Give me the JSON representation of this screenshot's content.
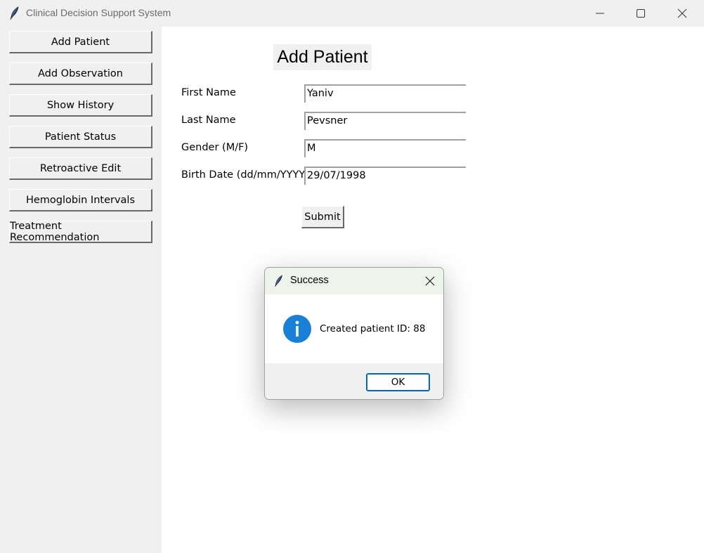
{
  "window": {
    "title": "Clinical Decision Support System",
    "icon": "feather-icon"
  },
  "sidebar": {
    "items": [
      {
        "label": "Add Patient"
      },
      {
        "label": "Add Observation"
      },
      {
        "label": "Show History"
      },
      {
        "label": "Patient Status"
      },
      {
        "label": "Retroactive Edit"
      },
      {
        "label": "Hemoglobin Intervals"
      },
      {
        "label": "Treatment Recommendation"
      }
    ]
  },
  "form": {
    "heading": "Add Patient",
    "fields": [
      {
        "label": "First Name",
        "value": "Yaniv"
      },
      {
        "label": "Last Name",
        "value": "Pevsner"
      },
      {
        "label": "Gender (M/F)",
        "value": "M"
      },
      {
        "label": "Birth Date (dd/mm/YYYY)",
        "value": "29/07/1998"
      }
    ],
    "submit_label": "Submit"
  },
  "dialog": {
    "title": "Success",
    "message": "Created patient ID: 88",
    "ok_label": "OK",
    "icon": "info-icon"
  },
  "colors": {
    "accent": "#0067c0",
    "info_blue": "#1a7fd6",
    "dialog_title_bg": "#eef3ec"
  }
}
